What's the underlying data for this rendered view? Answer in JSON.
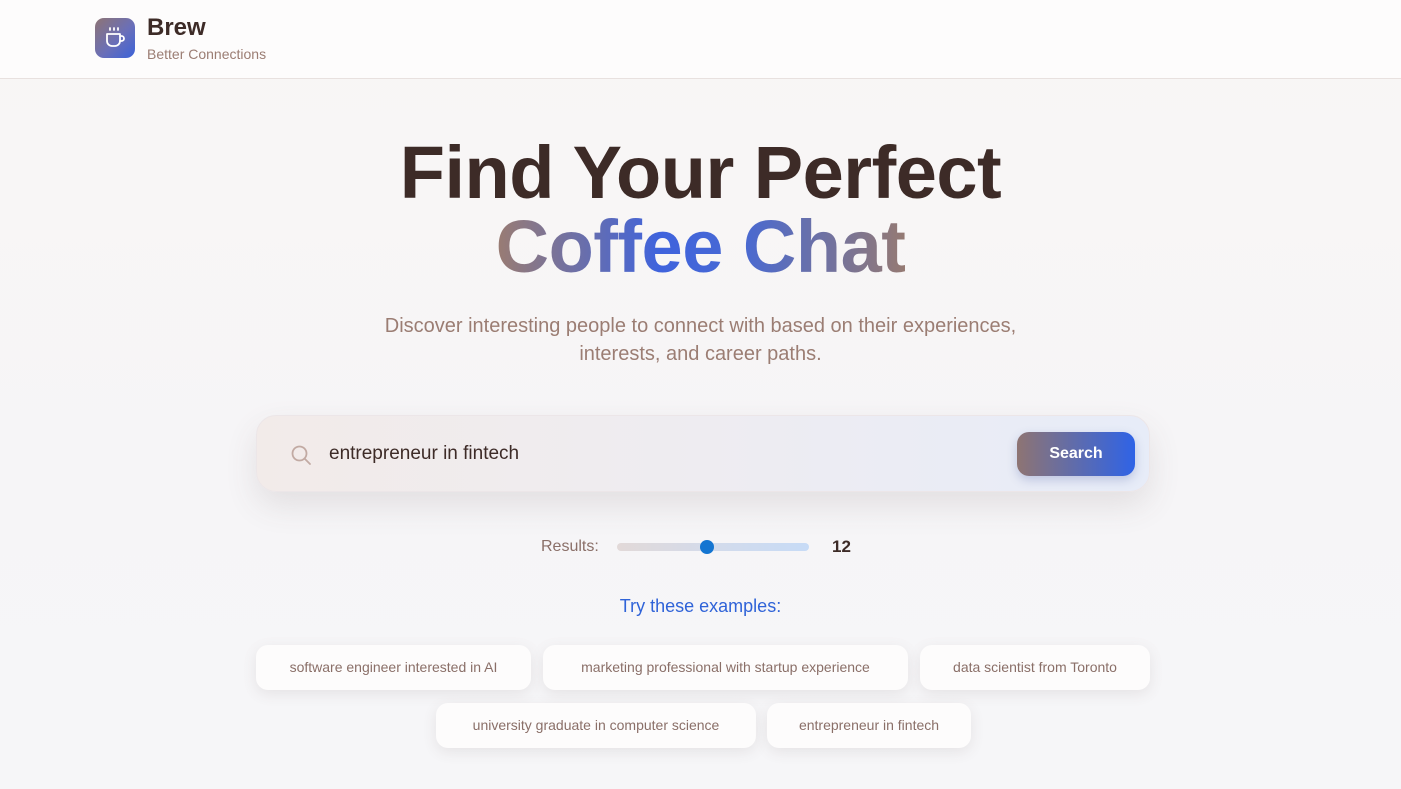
{
  "brand": {
    "name": "Brew",
    "tagline": "Better Connections",
    "logo_icon": "coffee-cup-icon"
  },
  "hero": {
    "line1": "Find Your Perfect",
    "line2": "Coffee Chat"
  },
  "subtitle": {
    "line1": "Discover interesting people to connect with based on their experiences,",
    "line2": "interests, and career paths."
  },
  "search": {
    "value": "entrepreneur in fintech",
    "button_label": "Search",
    "icon": "search-icon"
  },
  "results": {
    "label": "Results:",
    "value": "12",
    "slider_fraction": 0.47
  },
  "examples": {
    "title": "Try these examples:",
    "chips": [
      "software engineer interested in AI",
      "marketing professional with startup experience",
      "data scientist from Toronto",
      "university graduate in computer science",
      "entrepreneur in fintech"
    ]
  },
  "colors": {
    "accent_blue": "#2f63e6",
    "brand_brown": "#3d2b27",
    "muted_brown": "#9b7d73"
  }
}
